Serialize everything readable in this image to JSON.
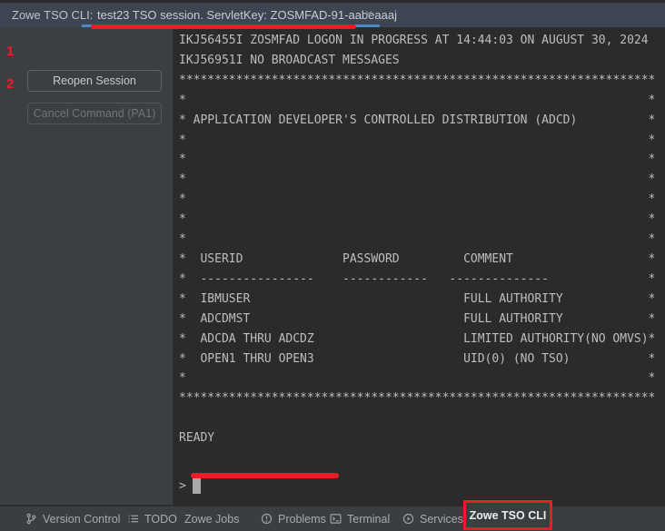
{
  "colors": {
    "annotation_red": "#ed1c24",
    "tab_indicator_blue": "#4a88c7",
    "header_background": "#3d4452",
    "terminal_background": "#2b2b2b",
    "sidebar_background": "#3c3f41",
    "statusbar_background": "#3b3e40",
    "terminal_text": "#bdbdbd"
  },
  "header": {
    "tool_label": "Zowe TSO CLI:",
    "tab": {
      "title": "test23 TSO session. ServletKey: ZOSMFAD-91-aabeaaaj",
      "close_icon": "×"
    }
  },
  "sidebar": {
    "buttons": [
      {
        "label": "Reopen Session",
        "enabled": true,
        "annotation": "1"
      },
      {
        "label": "Cancel Command (PA1)",
        "enabled": false,
        "annotation": "2"
      }
    ]
  },
  "terminal": {
    "lines": [
      "IKJ56455I ZOSMFAD LOGON IN PROGRESS AT 14:44:03 ON AUGUST 30, 2024",
      "IKJ56951I NO BROADCAST MESSAGES",
      "*******************************************************************",
      "*                                                                 *",
      "* APPLICATION DEVELOPER'S CONTROLLED DISTRIBUTION (ADCD)          *",
      "*                                                                 *",
      "*                                                                 *",
      "*                                                                 *",
      "*                                                                 *",
      "*                                                                 *",
      "*                                                                 *",
      "*  USERID              PASSWORD         COMMENT                   *",
      "*  ----------------    ------------   --------------              *",
      "*  IBMUSER                              FULL AUTHORITY            *",
      "*  ADCDMST                              FULL AUTHORITY            *",
      "*  ADCDA THRU ADCDZ                     LIMITED AUTHORITY(NO OMVS)*",
      "*  OPEN1 THRU OPEN3                     UID(0) (NO TSO)           *",
      "*                                                                 *",
      "*******************************************************************",
      "",
      "READY"
    ],
    "prompt": {
      "symbol": ">"
    }
  },
  "status_bar": {
    "items": [
      {
        "label": "Version Control",
        "icon": "git-branch-icon"
      },
      {
        "label": "TODO",
        "icon": "todo-list-icon"
      },
      {
        "label": "Zowe Jobs",
        "icon": null
      },
      {
        "label": "Problems",
        "icon": "problems-icon"
      },
      {
        "label": "Terminal",
        "icon": "terminal-icon"
      },
      {
        "label": "Services",
        "icon": "services-play-icon"
      },
      {
        "label": "Zowe TSO CLI",
        "icon": null,
        "active": true,
        "highlighted_with_red_box": true
      }
    ]
  },
  "annotations": {
    "numbers": [
      {
        "label": "1"
      },
      {
        "label": "2"
      }
    ]
  }
}
